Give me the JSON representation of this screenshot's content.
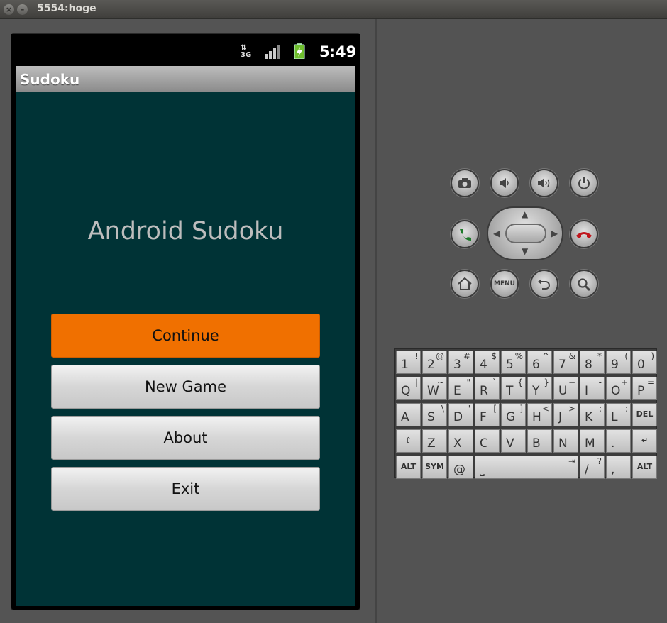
{
  "window": {
    "title": "5554:hoge",
    "close_glyph": "×",
    "minimize_glyph": "–"
  },
  "statusbar": {
    "network": "3G",
    "time": "5:49"
  },
  "app": {
    "title": "Sudoku",
    "heading": "Android Sudoku",
    "buttons": [
      "Continue",
      "New Game",
      "About",
      "Exit"
    ]
  },
  "controls": {
    "row1": [
      "camera-icon",
      "volume-down-icon",
      "volume-up-icon",
      "power-icon"
    ],
    "menu_label": "MENU"
  },
  "keyboard": {
    "row1": [
      [
        "1",
        "!"
      ],
      [
        "2",
        "@"
      ],
      [
        "3",
        "#"
      ],
      [
        "4",
        "$"
      ],
      [
        "5",
        "%"
      ],
      [
        "6",
        "^"
      ],
      [
        "7",
        "&"
      ],
      [
        "8",
        "*"
      ],
      [
        "9",
        "("
      ],
      [
        "0",
        ")"
      ]
    ],
    "row2": [
      [
        "Q",
        "|"
      ],
      [
        "W",
        "~"
      ],
      [
        "E",
        "\""
      ],
      [
        "R",
        "`"
      ],
      [
        "T",
        "{"
      ],
      [
        "Y",
        "}"
      ],
      [
        "U",
        "−"
      ],
      [
        "I",
        "-"
      ],
      [
        "O",
        "+"
      ],
      [
        "P",
        "="
      ]
    ],
    "row3": [
      [
        "A",
        ""
      ],
      [
        "S",
        "\\"
      ],
      [
        "D",
        "'"
      ],
      [
        "F",
        "["
      ],
      [
        "G",
        "]"
      ],
      [
        "H",
        "<"
      ],
      [
        "J",
        ">"
      ],
      [
        "K",
        ";"
      ],
      [
        "L",
        ":"
      ]
    ],
    "row4": [
      [
        "Z",
        ""
      ],
      [
        "X",
        ""
      ],
      [
        "C",
        ""
      ],
      [
        "V",
        ""
      ],
      [
        "B",
        ""
      ],
      [
        "N",
        ""
      ],
      [
        "M",
        ""
      ],
      [
        ".",
        ""
      ]
    ],
    "del": "DEL",
    "alt": "ALT",
    "sym": "SYM",
    "at": "@",
    "slash": "/",
    "question": "?",
    "comma": ","
  }
}
